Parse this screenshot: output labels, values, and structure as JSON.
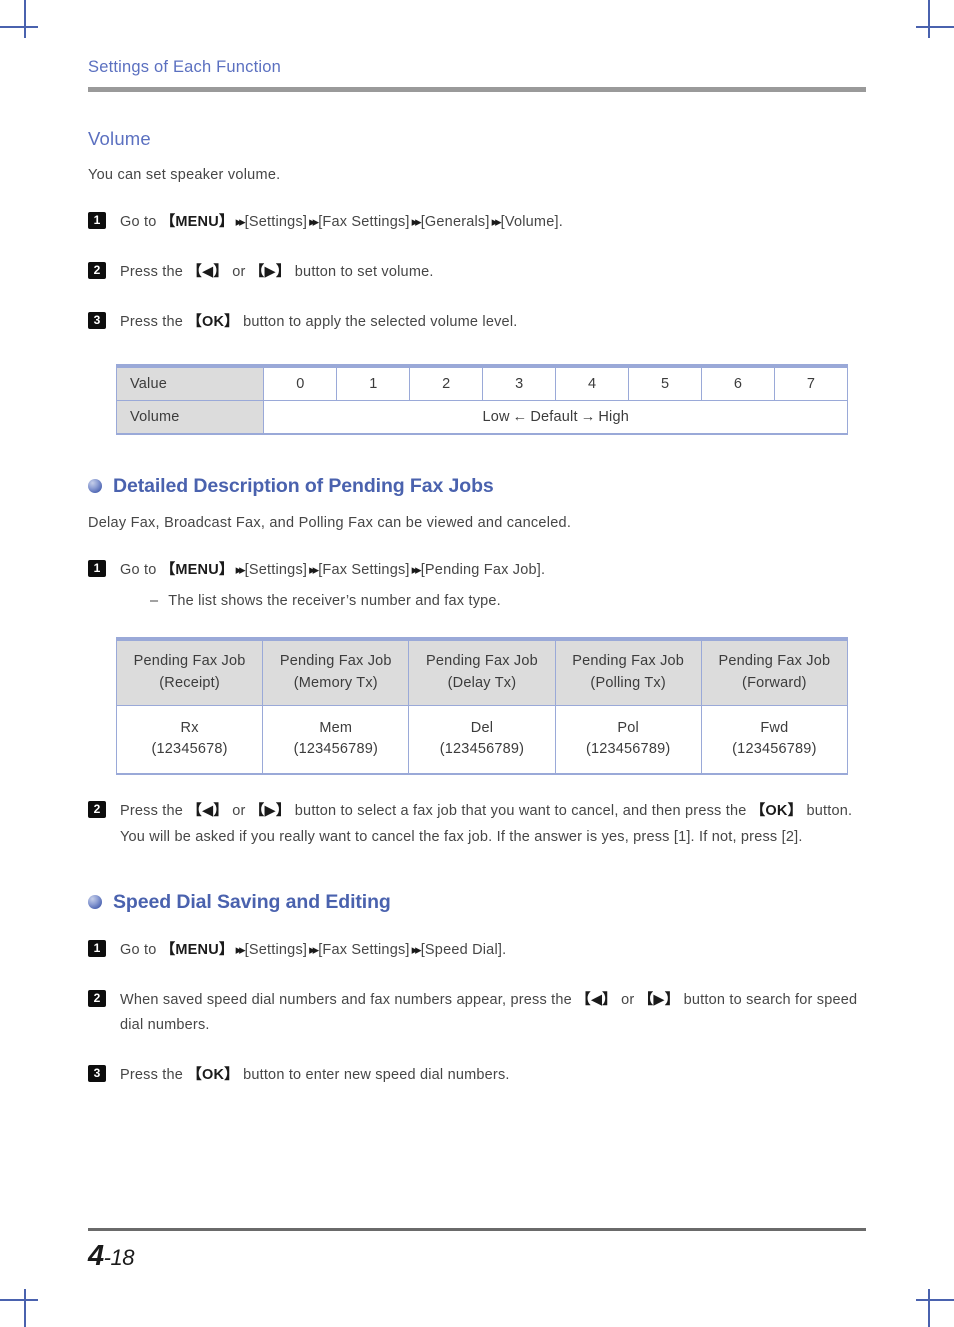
{
  "page": {
    "running_header": "Settings of Each Function",
    "page_number_major": "4",
    "page_number_minor": "-18",
    "accent_blue": "#5b70c0",
    "heading_blue": "#4a62ae",
    "rule_gray": "#9a9a9a",
    "table_border_blue": "#9aa9d8",
    "table_head_gray": "#dcdcdc"
  },
  "sections": {
    "volume": {
      "heading": "Volume",
      "intro": "You can set speaker volume.",
      "steps": [
        {
          "number": "1",
          "prefix": "Go to ",
          "menu": "【MENU】",
          "path": [
            "[Settings]",
            "[Fax Settings]",
            "[Generals]",
            "[Volume]"
          ],
          "suffix": "."
        },
        {
          "number": "2",
          "text_before": "Press the ",
          "key_left": "【◀】",
          "text_or": " or ",
          "key_right": "【▶】",
          "text_after": " button to set volume."
        },
        {
          "number": "3",
          "text_before": "Press the ",
          "key_ok": "【OK】",
          "text_after": " button to apply the selected volume level."
        }
      ],
      "table": {
        "row_headers": [
          "Value",
          "Volume"
        ],
        "values": [
          "0",
          "1",
          "2",
          "3",
          "4",
          "5",
          "6",
          "7"
        ],
        "volume_scale_low": "Low",
        "volume_scale_arrow_left": "←",
        "volume_scale_default": "Default",
        "volume_scale_arrow_right": "→",
        "volume_scale_high": "High"
      }
    },
    "pending_fax": {
      "heading": "Detailed Description of Pending Fax Jobs",
      "intro": "Delay Fax, Broadcast Fax, and Polling Fax can be viewed and canceled.",
      "step1": {
        "number": "1",
        "prefix": "Go to ",
        "menu": "【MENU】",
        "path": [
          "[Settings]",
          "[Fax Settings]",
          "[Pending Fax Job]"
        ],
        "suffix": "."
      },
      "note": {
        "dash": "–",
        "text": "The list shows the receiver’s number and fax type."
      },
      "table": {
        "headers": [
          {
            "line1": "Pending Fax Job",
            "line2": "(Receipt)"
          },
          {
            "line1": "Pending Fax Job",
            "line2": "(Memory Tx)"
          },
          {
            "line1": "Pending Fax Job",
            "line2": "(Delay Tx)"
          },
          {
            "line1": "Pending Fax Job",
            "line2": "(Polling Tx)"
          },
          {
            "line1": "Pending Fax Job",
            "line2": "(Forward)"
          }
        ],
        "values": [
          {
            "line1": "Rx",
            "line2": "(12345678)"
          },
          {
            "line1": "Mem",
            "line2": "(123456789)"
          },
          {
            "line1": "Del",
            "line2": "(123456789)"
          },
          {
            "line1": "Pol",
            "line2": "(123456789)"
          },
          {
            "line1": "Fwd",
            "line2": "(123456789)"
          }
        ]
      },
      "step2": {
        "number": "2",
        "t1": "Press the ",
        "key_left": "【◀】",
        "t2": " or ",
        "key_right": "【▶】",
        "t3": " button to select a fax job that you want to cancel, and then press the ",
        "key_ok": "【OK】",
        "t4": " button. You will be asked if you really want to cancel the fax job. If the answer is yes, press [1]. If not, press [2]."
      }
    },
    "speed_dial": {
      "heading": "Speed Dial Saving and Editing",
      "step1": {
        "number": "1",
        "prefix": "Go to ",
        "menu": "【MENU】",
        "path": [
          "[Settings]",
          "[Fax Settings]",
          "[Speed Dial]"
        ],
        "suffix": "."
      },
      "step2": {
        "number": "2",
        "t1": "When saved speed dial numbers and fax numbers appear, press the ",
        "key_left": "【◀】",
        "t2": " or ",
        "key_right": "【▶】",
        "t3": " button to search for speed dial numbers."
      },
      "step3": {
        "number": "3",
        "t1": "Press the ",
        "key_ok": "【OK】",
        "t2": " button to enter new speed dial numbers."
      }
    }
  },
  "icons": {
    "arrow_double": "▸▸",
    "sphere_bullet": "sphere-bullet-icon"
  }
}
